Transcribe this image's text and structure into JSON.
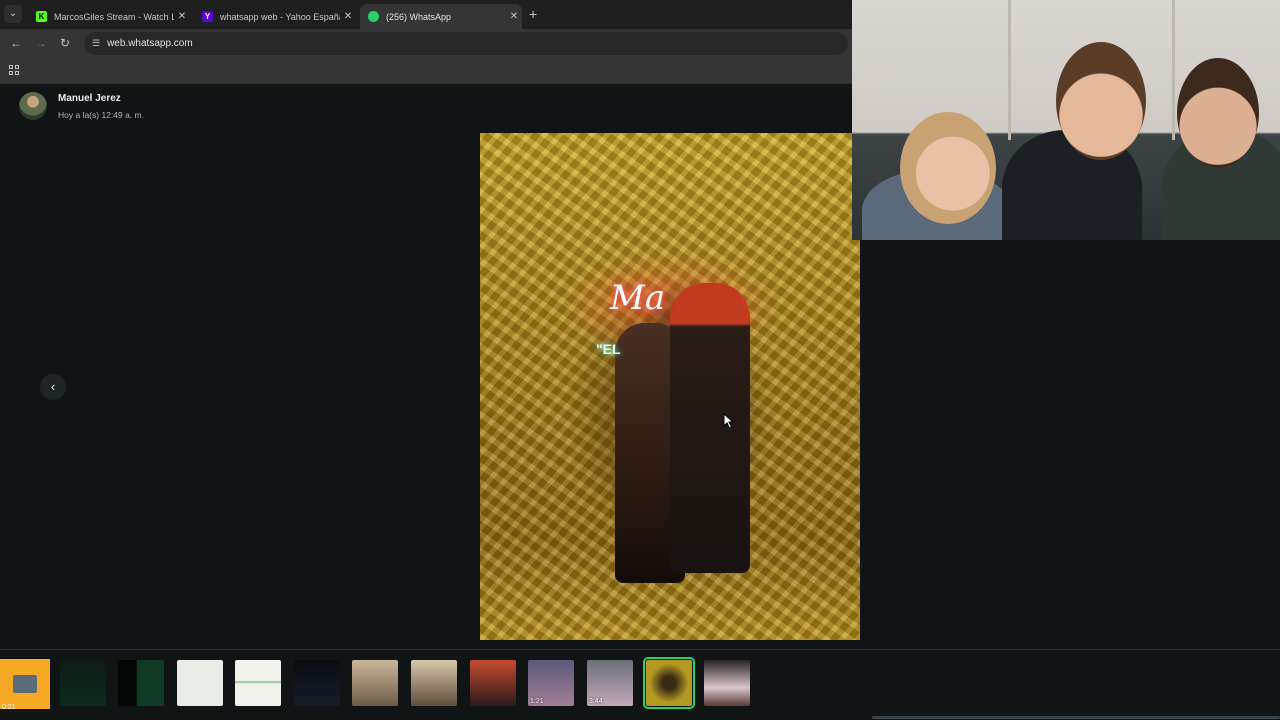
{
  "browser": {
    "tabs": [
      {
        "title": "MarcosGiles Stream - Watch Li",
        "favicon": "kick-icon",
        "active": false
      },
      {
        "title": "whatsapp web - Yahoo España",
        "favicon": "yahoo-icon",
        "active": false
      },
      {
        "title": "(256) WhatsApp",
        "favicon": "whatsapp-icon",
        "active": true
      }
    ],
    "url": "web.whatsapp.com"
  },
  "viewer": {
    "sender_name": "Manuel Jerez",
    "sender_time": "Hoy a la(s) 12:49 a. m."
  },
  "photo": {
    "neon_text": "Ma",
    "neon_text_2": "\"EL"
  },
  "thumbnails": [
    {
      "kind": "image",
      "duration": "0:21"
    },
    {
      "kind": "screenshot-dark",
      "duration": ""
    },
    {
      "kind": "screenshot-dark",
      "duration": ""
    },
    {
      "kind": "screenshot-light",
      "duration": ""
    },
    {
      "kind": "screenshot-light",
      "duration": ""
    },
    {
      "kind": "screenshot-dark",
      "duration": ""
    },
    {
      "kind": "photo",
      "duration": ""
    },
    {
      "kind": "photo",
      "duration": ""
    },
    {
      "kind": "photo",
      "duration": ""
    },
    {
      "kind": "video",
      "duration": "1:21"
    },
    {
      "kind": "video",
      "duration": "3:44"
    },
    {
      "kind": "photo",
      "duration": "",
      "selected": true
    },
    {
      "kind": "photo",
      "duration": ""
    }
  ],
  "colors": {
    "whatsapp_green": "#25d366",
    "background": "#111414"
  }
}
